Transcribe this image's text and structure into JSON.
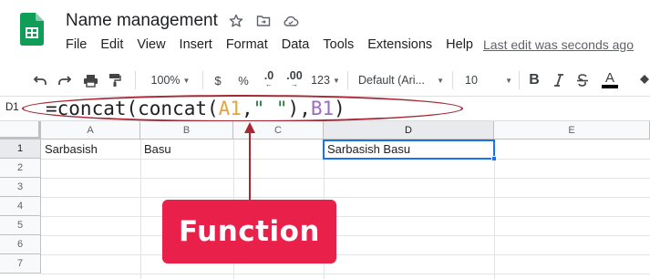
{
  "app": {
    "doc_title": "Name management",
    "last_edit": "Last edit was seconds ago",
    "menu": [
      "File",
      "Edit",
      "View",
      "Insert",
      "Format",
      "Data",
      "Tools",
      "Extensions",
      "Help"
    ]
  },
  "toolbar": {
    "zoom": "100%",
    "currency": "$",
    "percent": "%",
    "decrease_decimal": ".0",
    "increase_decimal": ".00",
    "more_formats": "123",
    "font": "Default (Ari...",
    "font_size": "10",
    "bold": "B",
    "text_color": "A"
  },
  "formula_bar": {
    "name_box": "D1",
    "formula_parts": {
      "p1": "=concat(concat(",
      "ref1": "A1",
      "p2": ",",
      "str": "\" \"",
      "p3": "),",
      "ref2": "B1",
      "p4": ")"
    }
  },
  "sheet": {
    "columns": [
      "A",
      "B",
      "C",
      "D",
      "E"
    ],
    "rows": [
      "1",
      "2",
      "3",
      "4",
      "5",
      "6",
      "7"
    ],
    "cells": {
      "A1": "Sarbasish",
      "B1": "Basu",
      "D1": "Sarbasish Basu"
    }
  },
  "annotation": {
    "label": "Function"
  },
  "colors": {
    "annotation_fill": "#e8204a",
    "annotation_outline": "#a52834",
    "selection": "#1a73e8",
    "sheets_green": "#0f9d58"
  }
}
